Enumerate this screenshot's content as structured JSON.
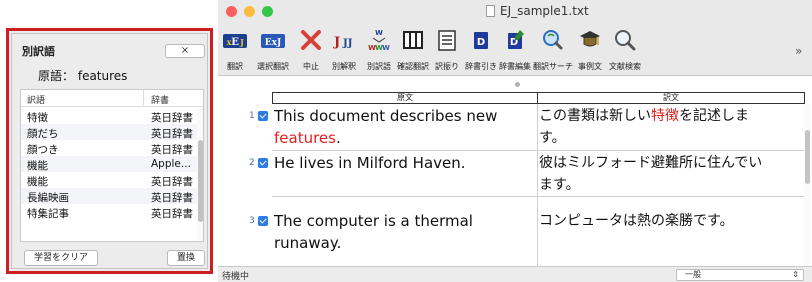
{
  "panel": {
    "title": "別訳語",
    "close_label": "×",
    "source_prefix": "原語：",
    "source_word": "features",
    "col_translation": "訳語",
    "col_dictionary": "辞書",
    "rows": [
      {
        "term": "特徴",
        "dict": "英日辞書"
      },
      {
        "term": "顔だち",
        "dict": "英日辞書"
      },
      {
        "term": "顔つき",
        "dict": "英日辞書"
      },
      {
        "term": "機能",
        "dict": "Apple..."
      },
      {
        "term": "機能",
        "dict": "英日辞書"
      },
      {
        "term": "長編映画",
        "dict": "英日辞書"
      },
      {
        "term": "特集記事",
        "dict": "英日辞書"
      }
    ],
    "clear_label": "学習をクリア",
    "replace_label": "置換"
  },
  "window": {
    "title": "EJ_sample1.txt",
    "traffic_colors": [
      "#fc605c",
      "#fdbc40",
      "#34c84a"
    ]
  },
  "toolbar": [
    {
      "label": "翻訳",
      "icon": "translate-icon"
    },
    {
      "label": "選択翻訳",
      "icon": "selection-translate-icon"
    },
    {
      "label": "中止",
      "icon": "stop-icon"
    },
    {
      "label": "別解釈",
      "icon": "alternate-interpretation-icon"
    },
    {
      "label": "別訳語",
      "icon": "alternate-translation-icon"
    },
    {
      "label": "確認翻訳",
      "icon": "confirm-translate-icon"
    },
    {
      "label": "訳振り",
      "icon": "interlinear-icon"
    },
    {
      "label": "辞書引き",
      "icon": "dictionary-lookup-icon"
    },
    {
      "label": "辞書編集",
      "icon": "dictionary-edit-icon"
    },
    {
      "label": "翻訳サーチ",
      "icon": "translation-search-icon"
    },
    {
      "label": "事例文",
      "icon": "example-sentence-icon"
    },
    {
      "label": "文献検索",
      "icon": "literature-search-icon"
    }
  ],
  "toolbar_more": "»",
  "table": {
    "col_source": "原文",
    "col_target": "訳文",
    "rows": [
      {
        "num": "1",
        "src_a": "This document describes new",
        "src_b": "features",
        "src_c": ".",
        "tgt_a": "この書類は新しい",
        "tgt_b": "特徴",
        "tgt_c": "を記述しま",
        "tgt_d": "す。"
      },
      {
        "num": "2",
        "src": "He lives in Milford Haven.",
        "tgt_a": "彼はミルフォード避難所に住んでい",
        "tgt_b": "ます。"
      },
      {
        "num": "3",
        "src_a": "The computer is a thermal",
        "src_b": "runaway.",
        "tgt": "コンピュータは熱の楽勝です。"
      }
    ]
  },
  "status": {
    "text": "待機中",
    "select_value": "一般"
  },
  "colors": {
    "highlight": "#e02020",
    "panel_border": "#cc1f25",
    "checkbox": "#2f7ce0"
  }
}
